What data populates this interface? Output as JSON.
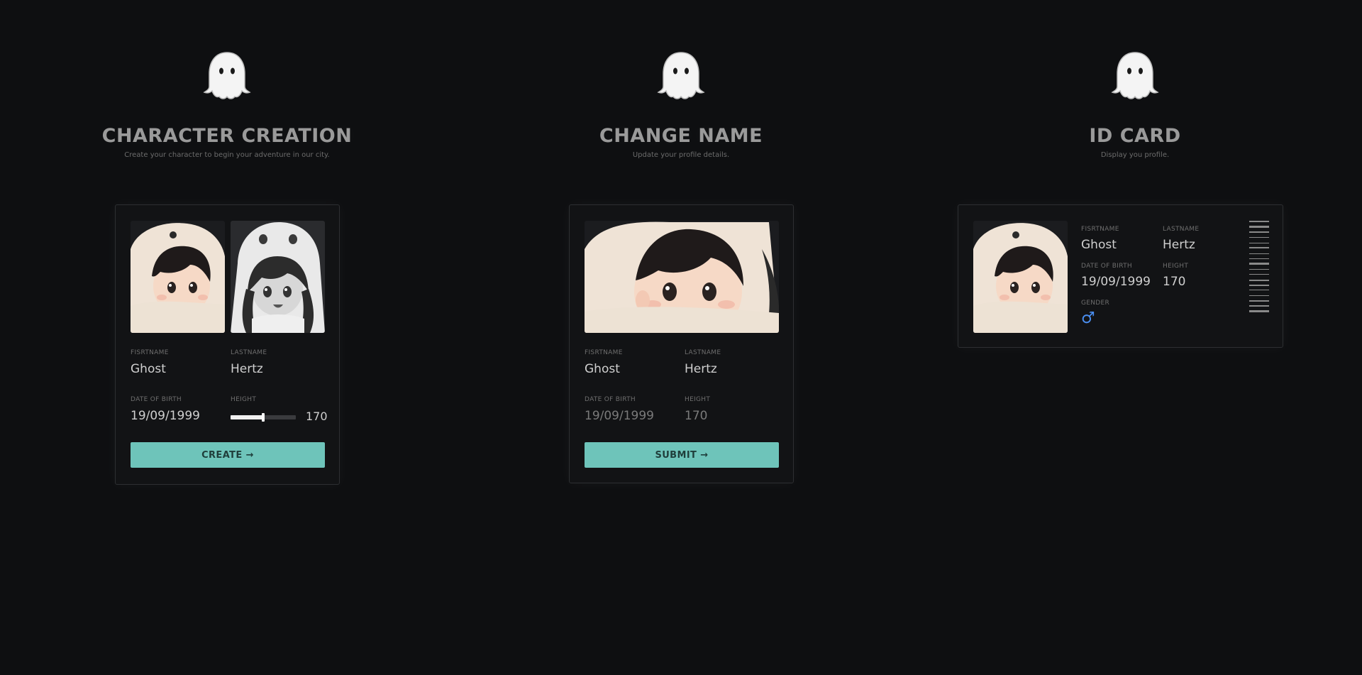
{
  "panels": {
    "create": {
      "title": "CHARACTER CREATION",
      "subtitle": "Create your character to begin your adventure in our city.",
      "firstname_label": "FISRTNAME",
      "firstname_value": "Ghost",
      "lastname_label": "LASTNAME",
      "lastname_value": "Hertz",
      "dob_label": "DATE OF BIRTH",
      "dob_value": "19/09/1999",
      "height_label": "HEIGHT",
      "height_value": "170",
      "height_slider_fraction": 0.5,
      "button_label": "CREATE →"
    },
    "change": {
      "title": "CHANGE NAME",
      "subtitle": "Update your profile details.",
      "firstname_label": "FISRTNAME",
      "firstname_value": "Ghost",
      "lastname_label": "LASTNAME",
      "lastname_value": "Hertz",
      "dob_label": "DATE OF BIRTH",
      "dob_value": "19/09/1999",
      "height_label": "HEIGHT",
      "height_value": "170",
      "button_label": "SUBMIT →"
    },
    "idcard": {
      "title": "ID CARD",
      "subtitle": "Display you profile.",
      "firstname_label": "FISRTNAME",
      "firstname_value": "Ghost",
      "lastname_label": "LASTNAME",
      "lastname_value": "Hertz",
      "dob_label": "DATE OF BIRTH",
      "dob_value": "19/09/1999",
      "height_label": "HEIGHT",
      "height_value": "170",
      "gender_label": "GENDER",
      "gender_symbol": "♂"
    }
  },
  "icons": {
    "hero": "ghost-icon",
    "gender": "male-symbol-icon"
  },
  "colors": {
    "background": "#0e0f11",
    "card": "#121315",
    "accent": "#6ec4ba",
    "gender": "#4a8ef0"
  }
}
